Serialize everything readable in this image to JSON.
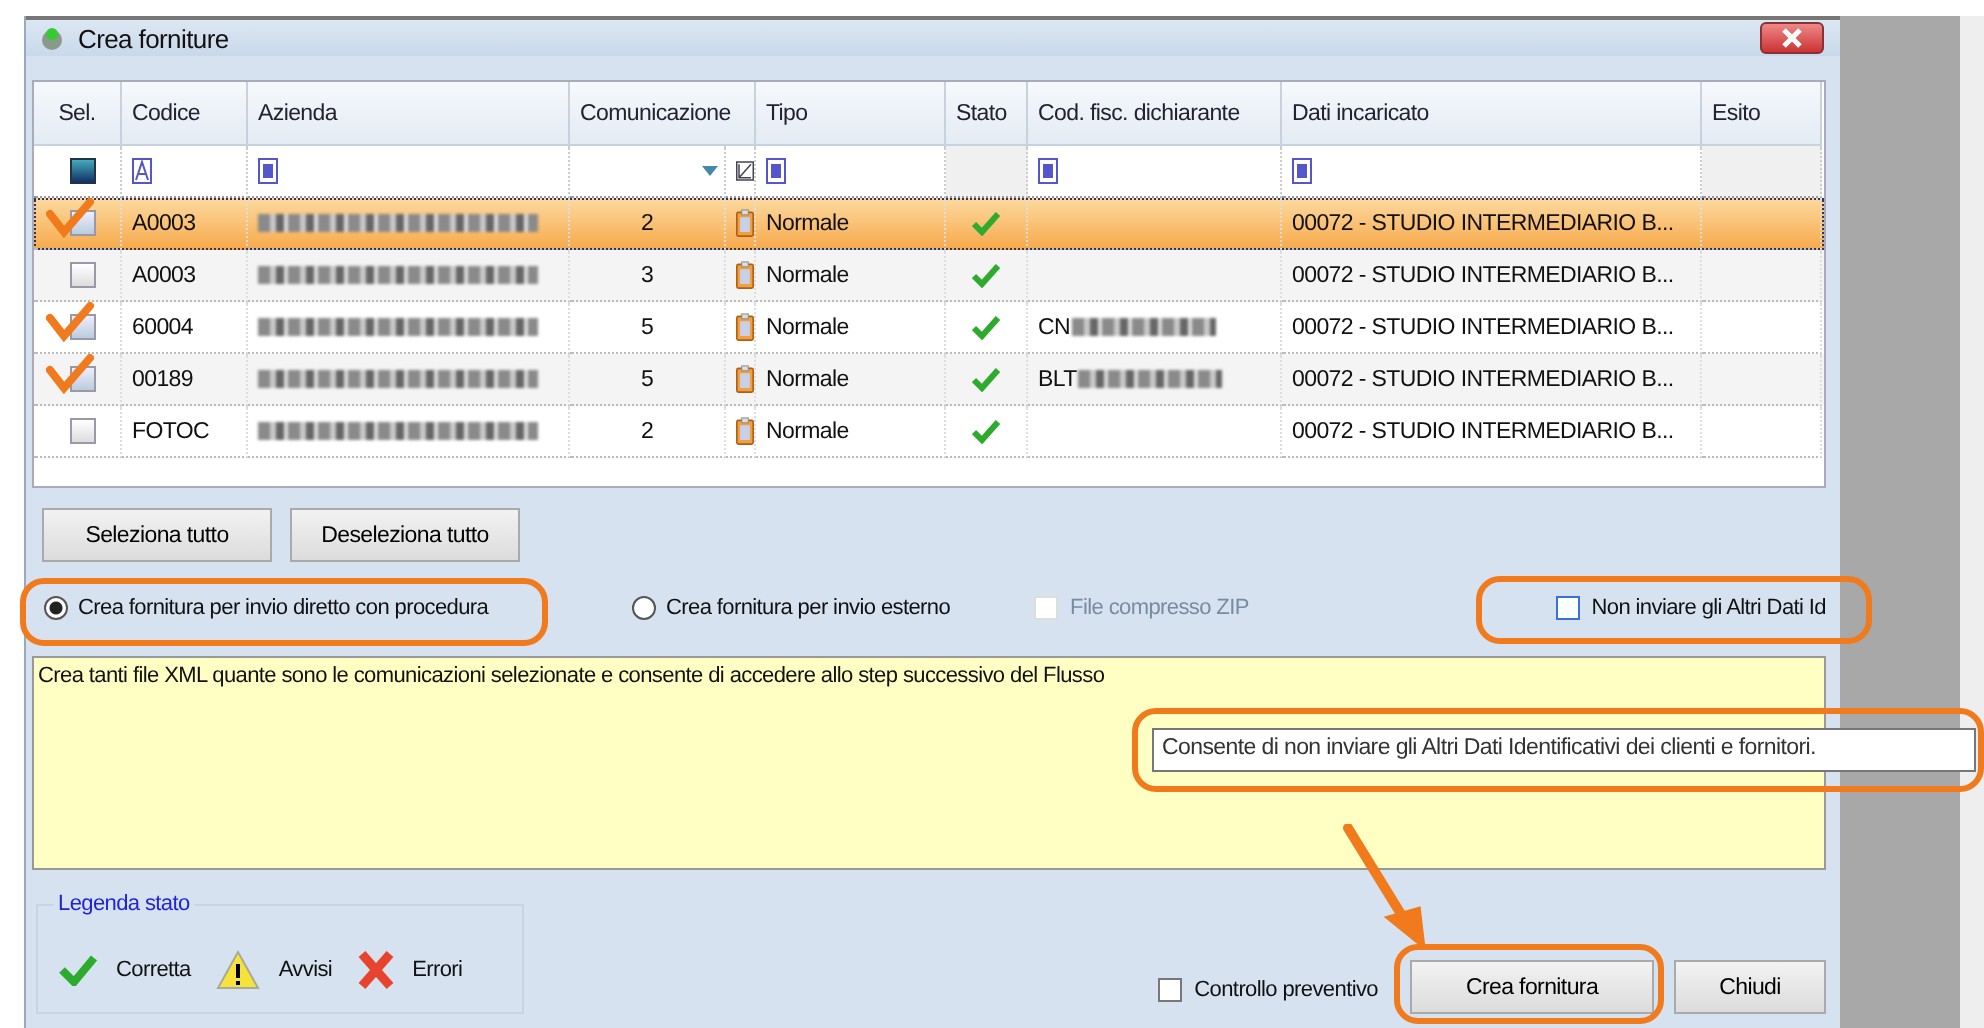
{
  "window": {
    "title": "Crea forniture"
  },
  "table": {
    "columns": [
      "Sel.",
      "Codice",
      "Azienda",
      "Comunicazione",
      "Tipo",
      "Stato",
      "Cod. fisc. dichiarante",
      "Dati incaricato",
      "Esito"
    ],
    "select_all_checked": true,
    "rows": [
      {
        "selected": true,
        "highlighted": true,
        "codice": "A0003",
        "comunicazione": "2",
        "tipo": "Normale",
        "kind": "correct",
        "dati": "00072 - STUDIO INTERMEDIARIO B..."
      },
      {
        "selected": false,
        "highlighted": false,
        "codice": "A0003",
        "comunicazione": "3",
        "tipo": "Normale",
        "kind": "correct",
        "dati": "00072 - STUDIO INTERMEDIARIO B..."
      },
      {
        "selected": true,
        "highlighted": false,
        "codice": "60004",
        "comunicazione": "5",
        "tipo": "Normale",
        "kind": "correct",
        "cod_fisc": "CN",
        "dati": "00072 - STUDIO INTERMEDIARIO B..."
      },
      {
        "selected": true,
        "highlighted": false,
        "codice": "00189",
        "comunicazione": "5",
        "tipo": "Normale",
        "kind": "correct",
        "cod_fisc": "BLT",
        "dati": "00072 - STUDIO INTERMEDIARIO B..."
      },
      {
        "selected": false,
        "highlighted": false,
        "codice": "FOTOC",
        "comunicazione": "2",
        "tipo": "Normale",
        "kind": "correct",
        "dati": "00072 - STUDIO INTERMEDIARIO B..."
      }
    ]
  },
  "select_buttons": [
    "Seleziona tutto",
    "Deseleziona tutto"
  ],
  "modes": [
    {
      "label": "Crea fornitura per invio diretto con procedura",
      "selected": true
    },
    {
      "label": "Crea fornitura per invio esterno",
      "selected": false
    }
  ],
  "zip": {
    "label": "File compresso ZIP",
    "checked": false,
    "disabled": true
  },
  "non_inviare": {
    "label": "Non inviare gli Altri Dati Id",
    "checked": false
  },
  "description": "Crea tanti file XML quante sono le comunicazioni selezionate e consente di accedere allo step successivo del Flusso",
  "tooltip": "Consente di non inviare gli Altri Dati Identificativi dei clienti e fornitori.",
  "legend": {
    "title": "Legenda stato",
    "items": [
      {
        "kind": "correct",
        "label": "Corretta"
      },
      {
        "kind": "warning",
        "label": "Avvisi"
      },
      {
        "kind": "error",
        "label": "Errori"
      }
    ]
  },
  "controllo": {
    "label": "Controllo preventivo",
    "checked": false
  },
  "buttons": [
    "Crea fornitura",
    "Chiudi"
  ]
}
